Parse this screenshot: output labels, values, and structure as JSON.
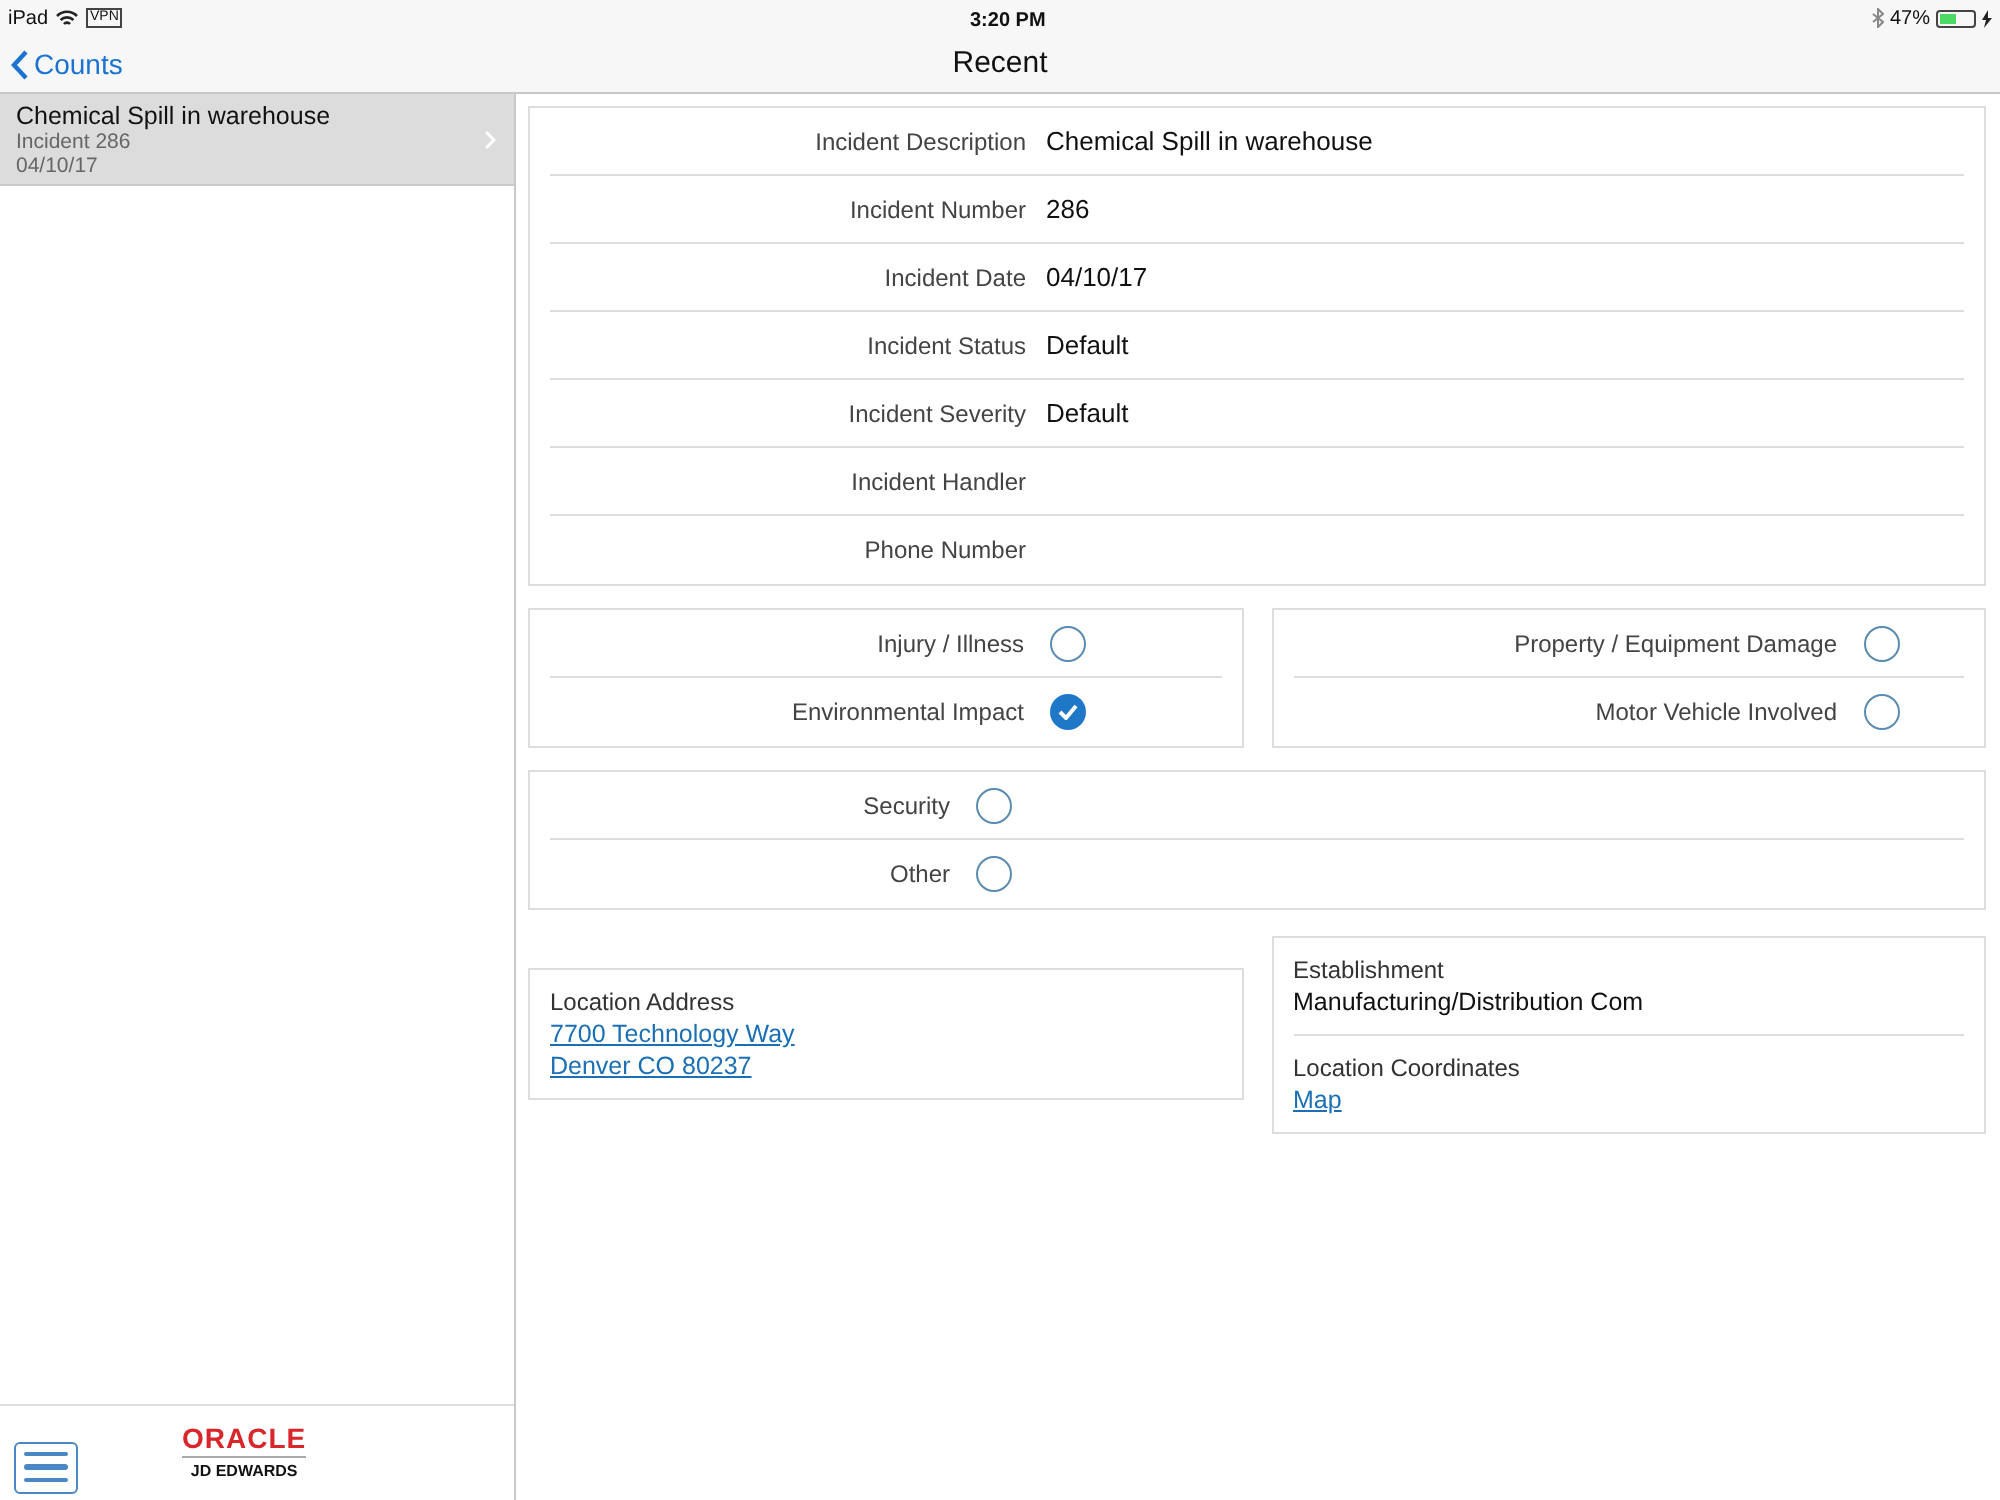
{
  "status_bar": {
    "device": "iPad",
    "vpn": "VPN",
    "time": "3:20 PM",
    "battery": "47%"
  },
  "nav": {
    "back": "Counts",
    "title": "Recent"
  },
  "sidebar": {
    "items": [
      {
        "title": "Chemical Spill in warehouse",
        "subtitle": "Incident 286",
        "date": "04/10/17",
        "selected": true
      }
    ]
  },
  "details": [
    {
      "label": "Incident Description",
      "value": "Chemical Spill in warehouse"
    },
    {
      "label": "Incident Number",
      "value": "286"
    },
    {
      "label": "Incident Date",
      "value": "04/10/17"
    },
    {
      "label": "Incident Status",
      "value": "Default"
    },
    {
      "label": "Incident Severity",
      "value": "Default"
    },
    {
      "label": "Incident Handler"
    },
    {
      "label": "Phone Number"
    }
  ],
  "check_groups": [
    [
      {
        "label": "Injury / Illness",
        "checked": false
      },
      {
        "label": "Environmental Impact",
        "checked": true
      }
    ],
    [
      {
        "label": "Property / Equipment Damage",
        "checked": false
      },
      {
        "label": "Motor Vehicle Involved",
        "checked": false
      }
    ]
  ],
  "check_group_wide": [
    {
      "label": "Security",
      "checked": false
    },
    {
      "label": "Other",
      "checked": false
    }
  ],
  "location": {
    "label": "Location Address",
    "lines": [
      "7700 Technology Way",
      "Denver CO 80237"
    ]
  },
  "establishment": {
    "label": "Establishment",
    "value": "Manufacturing/Distribution Com"
  },
  "coordinates": {
    "label": "Location Coordinates",
    "link": "Map"
  },
  "footer": {
    "brand": "ORACLE",
    "product": "JD EDWARDS"
  }
}
